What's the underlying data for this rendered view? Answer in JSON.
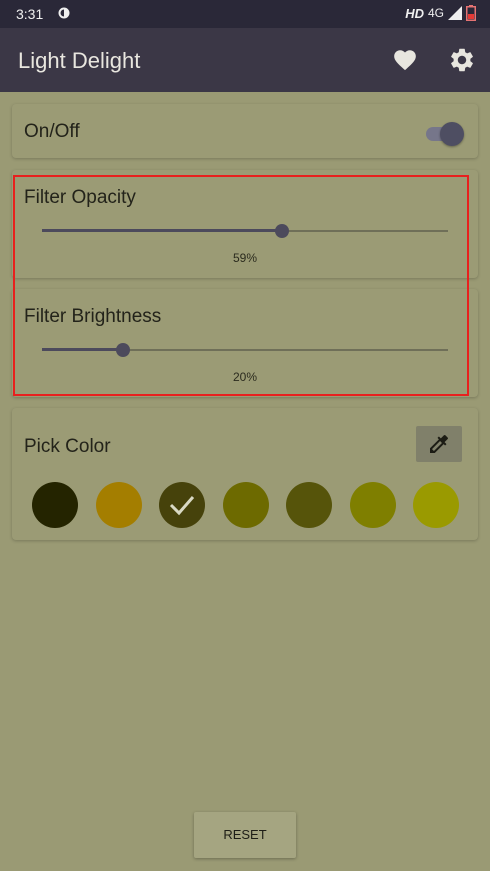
{
  "status_bar": {
    "time": "3:31",
    "hd_label": "HD",
    "network": "4G"
  },
  "app_bar": {
    "title": "Light Delight",
    "icons": [
      "heart-icon",
      "gear-icon"
    ]
  },
  "power_card": {
    "label": "On/Off",
    "enabled": true
  },
  "filter_opacity": {
    "label": "Filter Opacity",
    "value": 59,
    "value_text": "59%"
  },
  "filter_brightness": {
    "label": "Filter Brightness",
    "value": 20,
    "value_text": "20%"
  },
  "color_card": {
    "label": "Pick Color",
    "picker_icon": "eyedropper-icon",
    "swatches": [
      {
        "color": "#242400",
        "selected": false
      },
      {
        "color": "#a47e00",
        "selected": false
      },
      {
        "color": "#46420b",
        "selected": true
      },
      {
        "color": "#6d6a00",
        "selected": false
      },
      {
        "color": "#56540a",
        "selected": false
      },
      {
        "color": "#7f7f00",
        "selected": false
      },
      {
        "color": "#9a9a00",
        "selected": false
      }
    ]
  },
  "reset_label": "RESET",
  "colors": {
    "background": "#9a9a74",
    "status_bar": "#2a2838",
    "app_bar": "#3b3746",
    "accent": "#4c4a5c",
    "highlight": "#e8201e"
  }
}
